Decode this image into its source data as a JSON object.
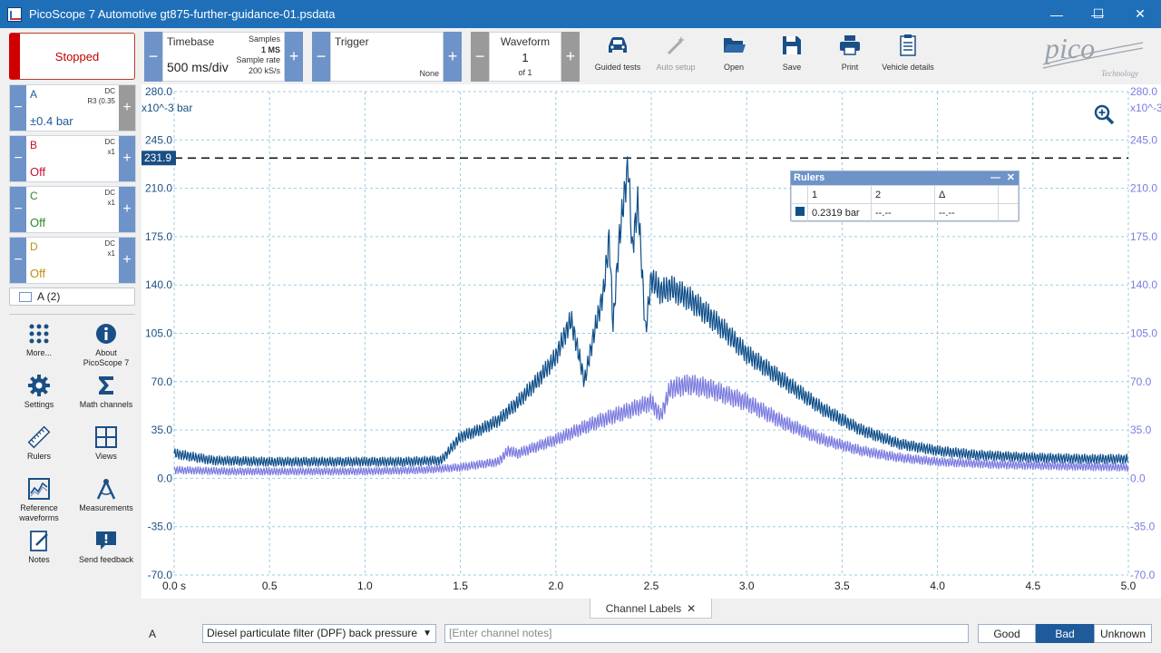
{
  "window": {
    "title": "PicoScope 7 Automotive gt875-further-guidance-01.psdata",
    "controls": [
      "—",
      "☐",
      "✕"
    ]
  },
  "run": {
    "label": "Stopped"
  },
  "timebase": {
    "label": "Timebase",
    "value": "500 ms/div",
    "samples_label": "Samples",
    "samples_value": "1 MS",
    "rate_label": "Sample rate",
    "rate_value": "200 kS/s"
  },
  "trigger": {
    "label": "Trigger",
    "value": "None"
  },
  "waveform": {
    "label": "Waveform",
    "value": "1",
    "of": "of 1"
  },
  "tools": [
    {
      "label": "Guided tests",
      "icon": "car-icon"
    },
    {
      "label": "Auto setup",
      "icon": "wand-icon"
    },
    {
      "label": "Open",
      "icon": "folder-icon"
    },
    {
      "label": "Save",
      "icon": "floppy-icon"
    },
    {
      "label": "Print",
      "icon": "printer-icon"
    },
    {
      "label": "Vehicle details",
      "icon": "clipboard-icon"
    }
  ],
  "logo": {
    "text": "pico",
    "sub": "Technology"
  },
  "channels": [
    {
      "name": "A",
      "coupling": "DC",
      "probe": "R3 (0.35",
      "range": "±0.4 bar",
      "color": "#1a5a99"
    },
    {
      "name": "B",
      "coupling": "DC",
      "probe": "x1",
      "range": "Off",
      "color": "#c8102e"
    },
    {
      "name": "C",
      "coupling": "DC",
      "probe": "x1",
      "range": "Off",
      "color": "#2a8a2a"
    },
    {
      "name": "D",
      "coupling": "DC",
      "probe": "x1",
      "range": "Off",
      "color": "#c09010"
    }
  ],
  "math_channel": {
    "label": "A (2)"
  },
  "side_tools": [
    {
      "label": "More...",
      "icon": "grid-dots-icon"
    },
    {
      "label": "About PicoScope 7",
      "icon": "info-icon"
    },
    {
      "label": "Settings",
      "icon": "gear-icon"
    },
    {
      "label": "Math channels",
      "icon": "sigma-icon"
    },
    {
      "label": "Rulers",
      "icon": "ruler-icon"
    },
    {
      "label": "Views",
      "icon": "views-icon"
    },
    {
      "label": "Reference waveforms",
      "icon": "reference-waveform-icon"
    },
    {
      "label": "Measurements",
      "icon": "caliper-icon"
    },
    {
      "label": "Notes",
      "icon": "notes-icon"
    },
    {
      "label": "Send feedback",
      "icon": "feedback-icon"
    }
  ],
  "chart_data": {
    "type": "line",
    "xlabel": "",
    "ylabel": "",
    "x_ticks": [
      "0.0 s",
      "0.5",
      "1.0",
      "1.5",
      "2.0",
      "2.5",
      "3.0",
      "3.5",
      "4.0",
      "4.5",
      "5.0"
    ],
    "xlim": [
      0,
      5
    ],
    "y_ticks_left": [
      "280.0",
      "245.0",
      "210.0",
      "175.0",
      "140.0",
      "105.0",
      "70.0",
      "35.0",
      "0.0",
      "-35.0",
      "-70.0"
    ],
    "y_ticks_right": [
      "280.0",
      "245.0",
      "210.0",
      "175.0",
      "140.0",
      "105.0",
      "70.0",
      "35.0",
      "0.0",
      "-35.0",
      "-70.0"
    ],
    "ylim": [
      -70,
      280
    ],
    "y_unit_left": "x10^-3 bar",
    "y_unit_right": "x10^-3",
    "grid": true,
    "ruler_level": 231.9,
    "ruler_label": "231.9",
    "series": [
      {
        "name": "A",
        "color": "#0f4f8a",
        "x": [
          0,
          0.2,
          0.5,
          0.8,
          1.0,
          1.2,
          1.4,
          1.5,
          1.6,
          1.7,
          1.8,
          1.9,
          2.0,
          2.08,
          2.12,
          2.15,
          2.2,
          2.25,
          2.28,
          2.3,
          2.33,
          2.35,
          2.38,
          2.4,
          2.43,
          2.45,
          2.47,
          2.5,
          2.55,
          2.6,
          2.7,
          2.8,
          2.9,
          3.0,
          3.2,
          3.4,
          3.6,
          3.8,
          4.0,
          4.2,
          4.5,
          4.8,
          5.0
        ],
        "y": [
          18,
          13,
          12,
          12,
          12,
          12,
          13,
          30,
          35,
          42,
          55,
          70,
          88,
          115,
          90,
          70,
          105,
          135,
          175,
          110,
          170,
          195,
          228,
          165,
          200,
          155,
          105,
          145,
          135,
          138,
          130,
          118,
          105,
          90,
          70,
          50,
          35,
          25,
          20,
          17,
          15,
          14,
          14
        ]
      },
      {
        "name": "Math A (2)",
        "color": "#7b7be0",
        "x": [
          0,
          0.3,
          0.6,
          1.0,
          1.3,
          1.5,
          1.7,
          1.75,
          1.8,
          2.0,
          2.2,
          2.4,
          2.5,
          2.55,
          2.6,
          2.7,
          2.8,
          3.0,
          3.2,
          3.4,
          3.6,
          3.8,
          4.0,
          4.3,
          4.6,
          5.0
        ],
        "y": [
          6,
          5,
          5,
          5,
          6,
          8,
          12,
          20,
          18,
          28,
          40,
          50,
          55,
          45,
          65,
          68,
          65,
          55,
          40,
          28,
          20,
          15,
          12,
          10,
          9,
          8
        ]
      }
    ]
  },
  "rulers_panel": {
    "title": "Rulers",
    "headers": [
      "",
      "1",
      "2",
      "Δ",
      ""
    ],
    "row": [
      "",
      "0.2319 bar",
      "--.--",
      "--.--",
      ""
    ]
  },
  "notes_bar": {
    "tab_label": "Channel Labels",
    "channel": "A",
    "label_value": "Diesel particulate filter (DPF) back pressure",
    "notes_placeholder": "[Enter channel notes]",
    "ratings": [
      "Good",
      "Bad",
      "Unknown"
    ],
    "active_rating": "Bad"
  }
}
